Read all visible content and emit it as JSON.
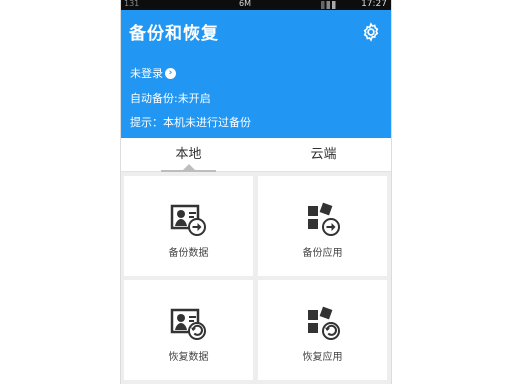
{
  "status_bar": {
    "left": "131",
    "network": "6M",
    "time": "17:27"
  },
  "header": {
    "title": "备份和恢复",
    "login": "未登录",
    "auto_backup": "自动备份:未开启",
    "tip": "提示：本机未进行过备份",
    "color": "#2196f3"
  },
  "tabs": [
    {
      "label": "本地",
      "selected": true
    },
    {
      "label": "云端",
      "selected": false
    }
  ],
  "actions": [
    {
      "label": "备份数据",
      "icon": "contact-card-backup-icon"
    },
    {
      "label": "备份应用",
      "icon": "apps-backup-icon"
    },
    {
      "label": "恢复数据",
      "icon": "contact-card-restore-icon"
    },
    {
      "label": "恢复应用",
      "icon": "apps-restore-icon"
    }
  ]
}
